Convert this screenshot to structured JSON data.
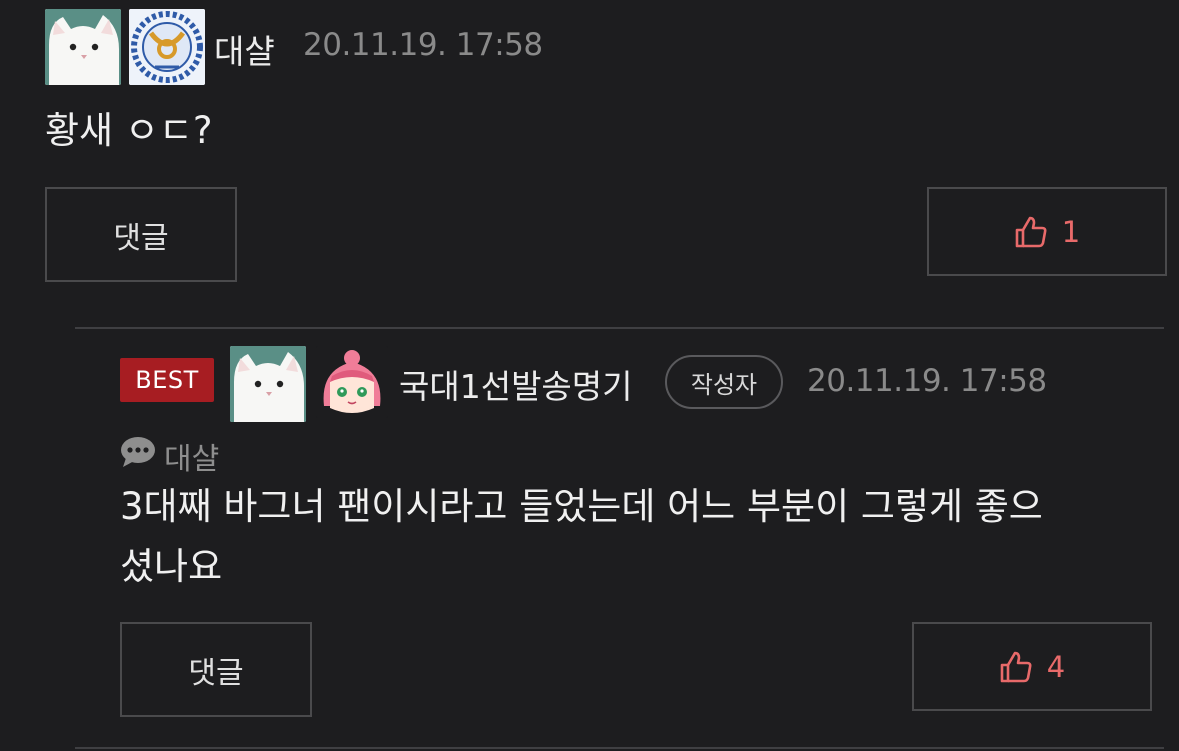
{
  "comment": {
    "author": "대샬",
    "timestamp": "20.11.19. 17:58",
    "text": "황새 ㅇㄷ?",
    "reply_label": "댓글",
    "like_count": "1",
    "avatar_icons": [
      "cat-avatar",
      "emblem-badge-avatar"
    ]
  },
  "reply": {
    "best_label": "BEST",
    "author": "국대1선발송명기",
    "writer_tag": "작성자",
    "timestamp": "20.11.19. 17:58",
    "reply_to_name": "대샬",
    "text_line1": "3대째 바그너 팬이시라고 들었는데 어느 부분이 그렇게 좋으",
    "text_line2": "셨나요",
    "reply_label": "댓글",
    "like_count": "4",
    "avatar_icons": [
      "cat-avatar",
      "pink-hair-character-avatar"
    ]
  },
  "colors": {
    "background": "#1d1d1f",
    "best_badge": "#a71d22",
    "like_accent": "#e86a6a",
    "border": "#4a4a4c"
  }
}
